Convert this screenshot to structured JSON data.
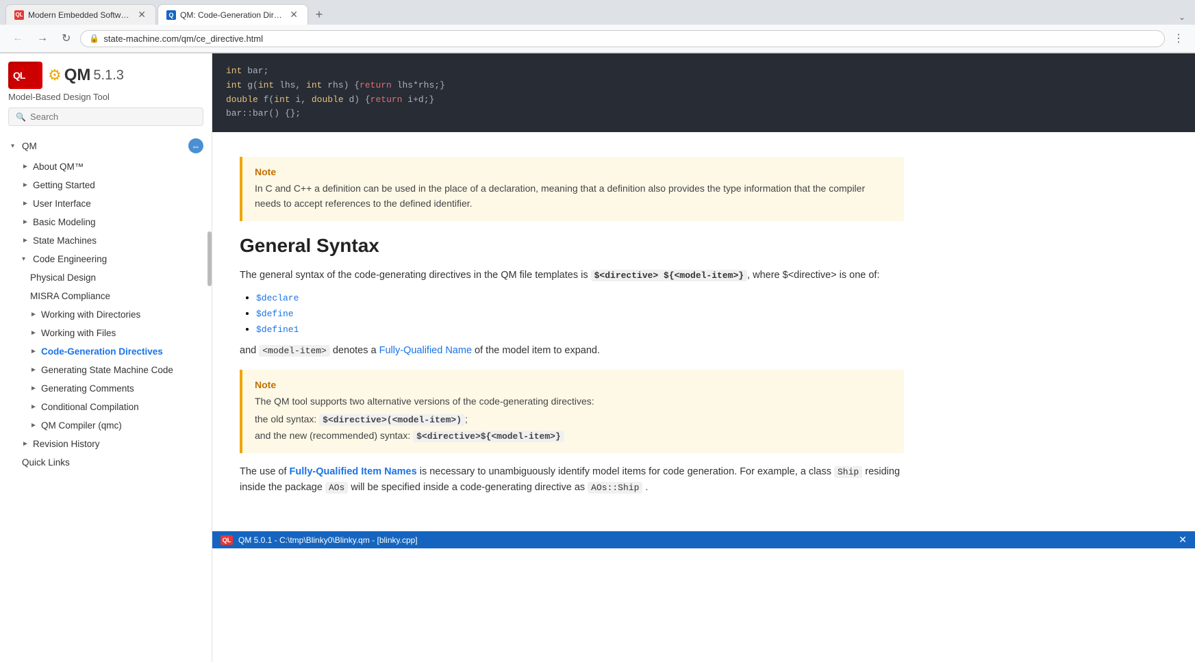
{
  "browser": {
    "tabs": [
      {
        "id": "tab1",
        "label": "Modern Embedded Software - C...",
        "favicon": "QL",
        "active": false
      },
      {
        "id": "tab2",
        "label": "QM: Code-Generation Directives",
        "favicon": "Q",
        "active": true
      }
    ],
    "address": "state-machine.com/qm/ce_directive.html",
    "new_tab_label": "+"
  },
  "sidebar": {
    "brand_name": "QM",
    "brand_version": "5.1.3",
    "brand_tagline": "Model-Based Design Tool",
    "search_placeholder": "Search",
    "nav": [
      {
        "id": "qm-root",
        "label": "QM",
        "level": 0,
        "arrow": "▾",
        "expanded": true
      },
      {
        "id": "about-qm",
        "label": "About QM™",
        "level": 1,
        "arrow": "►"
      },
      {
        "id": "getting-started",
        "label": "Getting Started",
        "level": 1,
        "arrow": "►"
      },
      {
        "id": "user-interface",
        "label": "User Interface",
        "level": 1,
        "arrow": "►"
      },
      {
        "id": "basic-modeling",
        "label": "Basic Modeling",
        "level": 1,
        "arrow": "►"
      },
      {
        "id": "state-machines",
        "label": "State Machines",
        "level": 1,
        "arrow": "►"
      },
      {
        "id": "code-engineering",
        "label": "Code Engineering",
        "level": 1,
        "arrow": "▾",
        "expanded": true
      },
      {
        "id": "physical-design",
        "label": "Physical Design",
        "level": 2,
        "arrow": ""
      },
      {
        "id": "misra-compliance",
        "label": "MISRA Compliance",
        "level": 2,
        "arrow": ""
      },
      {
        "id": "working-with-directories",
        "label": "Working with Directories",
        "level": 2,
        "arrow": "►"
      },
      {
        "id": "working-with-files",
        "label": "Working with Files",
        "level": 2,
        "arrow": "►"
      },
      {
        "id": "code-generation-directives",
        "label": "Code-Generation Directives",
        "level": 2,
        "arrow": "►",
        "active": true
      },
      {
        "id": "generating-state-machine-code",
        "label": "Generating State Machine Code",
        "level": 2,
        "arrow": "►"
      },
      {
        "id": "generating-comments",
        "label": "Generating Comments",
        "level": 2,
        "arrow": "►"
      },
      {
        "id": "conditional-compilation",
        "label": "Conditional Compilation",
        "level": 2,
        "arrow": "►"
      },
      {
        "id": "qm-compiler",
        "label": "QM Compiler (qmc)",
        "level": 2,
        "arrow": "►"
      },
      {
        "id": "revision-history",
        "label": "Revision History",
        "level": 1,
        "arrow": "►"
      },
      {
        "id": "quick-links",
        "label": "Quick Links",
        "level": 1,
        "arrow": ""
      }
    ]
  },
  "content": {
    "code_block": {
      "lines": [
        "int bar;",
        "int g(int lhs, int rhs) {return lhs*rhs;}",
        "double f(int i, double d) {return i+d;}",
        "bar::bar() {};"
      ]
    },
    "note1": {
      "title": "Note",
      "text": "In C and C++ a definition can be used in the place of a declaration, meaning that a definition also provides the type information that the compiler needs to accept references to the defined identifier."
    },
    "section_title": "General Syntax",
    "body1": "The general syntax of the code-generating directives in the QM file templates is",
    "syntax_strong": "$<directive> ${<model-item>}",
    "body1b": ", where $<directive> is one of:",
    "list_items": [
      "$declare",
      "$define",
      "$define1"
    ],
    "body2_pre": "and ",
    "body2_code": "<model-item>",
    "body2_mid": " denotes a ",
    "body2_link": "Fully-Qualified Name",
    "body2_post": " of the model item to expand.",
    "note2": {
      "title": "Note",
      "line1": "The QM tool supports two alternative versions of the code-generating directives:",
      "line2_pre": "the old syntax: ",
      "line2_code": "$<directive>(<model-item>)",
      "line3_pre": "and the new (recommended) syntax: ",
      "line3_code": "$<directive>${<model-item>}"
    },
    "body3_pre": "The use of ",
    "body3_link": "Fully-Qualified Item Names",
    "body3_mid": " is necessary to unambiguously identify model items for code generation. For example, a class ",
    "body3_code1": "Ship",
    "body3_post1": " residing inside the package ",
    "body3_code2": "AOs",
    "body3_post2": " will be specified inside a code-generating directive as ",
    "body3_code3": "AOs::Ship",
    "body3_end": " .",
    "bottom_bar": {
      "text": "QM 5.0.1 - C:\\tmp\\Blinky0\\Blinky.qm - [blinky.cpp]"
    }
  }
}
